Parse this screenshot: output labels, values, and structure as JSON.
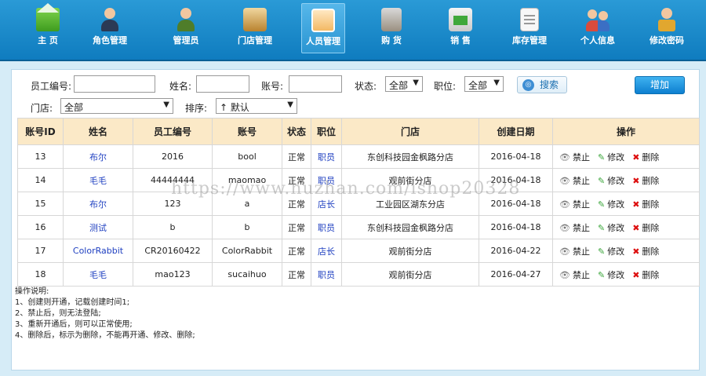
{
  "nav": {
    "items": [
      {
        "label": "主 页",
        "icon": "home-icon"
      },
      {
        "label": "角色管理",
        "icon": "role-icon"
      },
      {
        "label": "管理员",
        "icon": "admin-icon"
      },
      {
        "label": "门店管理",
        "icon": "store-icon"
      },
      {
        "label": "人员管理",
        "icon": "staff-icon",
        "active": true
      },
      {
        "label": "购 货",
        "icon": "purchase-icon"
      },
      {
        "label": "销 售",
        "icon": "sales-icon"
      },
      {
        "label": "库存管理",
        "icon": "inventory-icon"
      },
      {
        "label": "个人信息",
        "icon": "profile-icon"
      },
      {
        "label": "修改密码",
        "icon": "password-icon"
      }
    ]
  },
  "filters": {
    "employee_no_label": "员工编号:",
    "name_label": "姓名:",
    "account_label": "账号:",
    "status_label": "状态:",
    "status_value": "全部",
    "position_label": "职位:",
    "position_value": "全部",
    "search_label": "搜索",
    "add_label": "增加",
    "store_label": "门店:",
    "store_value": "全部",
    "sort_label": "排序:",
    "sort_value": "↑ 默认"
  },
  "table": {
    "headers": [
      "账号ID",
      "姓名",
      "员工编号",
      "账号",
      "状态",
      "职位",
      "门店",
      "创建日期",
      "操作"
    ],
    "ops": {
      "disable": "禁止",
      "edit": "修改",
      "delete": "删除"
    },
    "rows": [
      {
        "id": "13",
        "name": "布尔",
        "emp_no": "2016",
        "account": "bool",
        "status": "正常",
        "position": "职员",
        "store": "东创科技园金枫路分店",
        "date": "2016-04-18"
      },
      {
        "id": "14",
        "name": "毛毛",
        "emp_no": "44444444",
        "account": "maomao",
        "status": "正常",
        "position": "职员",
        "store": "观前街分店",
        "date": "2016-04-18"
      },
      {
        "id": "15",
        "name": "布尔",
        "emp_no": "123",
        "account": "a",
        "status": "正常",
        "position": "店长",
        "store": "工业园区湖东分店",
        "date": "2016-04-18"
      },
      {
        "id": "16",
        "name": "测试",
        "emp_no": "b",
        "account": "b",
        "status": "正常",
        "position": "职员",
        "store": "东创科技园金枫路分店",
        "date": "2016-04-18"
      },
      {
        "id": "17",
        "name": "ColorRabbit",
        "emp_no": "CR20160422",
        "account": "ColorRabbit",
        "status": "正常",
        "position": "店长",
        "store": "观前街分店",
        "date": "2016-04-22"
      },
      {
        "id": "18",
        "name": "毛毛",
        "emp_no": "mao123",
        "account": "sucaihuo",
        "status": "正常",
        "position": "职员",
        "store": "观前街分店",
        "date": "2016-04-27"
      }
    ]
  },
  "notes": [
    "操作说明:",
    "1、创建则开通，记载创建时间1;",
    "2、禁止后，则无法登陆;",
    "3、重新开通后，则可以正常使用;",
    "4、删除后，标示为删除，不能再开通、修改、删除;"
  ],
  "watermark": "https://www.huzhan.com/ishop20328"
}
